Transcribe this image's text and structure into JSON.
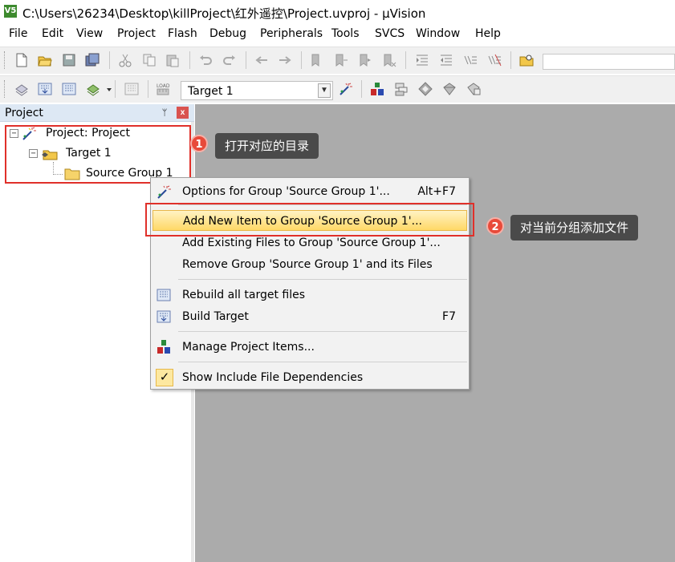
{
  "window": {
    "title": "C:\\Users\\26234\\Desktop\\killProject\\红外遥控\\Project.uvproj - µVision",
    "app_icon_text": "V5"
  },
  "menu": [
    "File",
    "Edit",
    "View",
    "Project",
    "Flash",
    "Debug",
    "Peripherals",
    "Tools",
    "SVCS",
    "Window",
    "Help"
  ],
  "toolbar": {
    "target_combo_value": "Target 1",
    "build_toolbar_load_label": "LOAD"
  },
  "project_panel": {
    "title": "Project",
    "pin_glyph": "ᛘ",
    "close_glyph": "x",
    "tree": {
      "root": "Project: Project",
      "target": "Target 1",
      "group": "Source Group 1"
    }
  },
  "context_menu": {
    "items": [
      {
        "label": "Options for Group 'Source Group 1'...",
        "shortcut": "Alt+F7",
        "icon": "options-wand-icon"
      },
      {
        "label": "Add New  Item to Group 'Source Group 1'...",
        "shortcut": "",
        "icon": "",
        "highlighted": true
      },
      {
        "label": "Add Existing Files to Group 'Source Group 1'...",
        "shortcut": "",
        "icon": ""
      },
      {
        "label": "Remove Group 'Source Group 1' and its Files",
        "shortcut": "",
        "icon": ""
      },
      {
        "label": "Rebuild all target files",
        "shortcut": "",
        "icon": "rebuild-icon"
      },
      {
        "label": "Build Target",
        "shortcut": "F7",
        "icon": "build-icon"
      },
      {
        "label": "Manage Project Items...",
        "shortcut": "",
        "icon": "manage-items-icon"
      },
      {
        "label": "Show Include File Dependencies",
        "shortcut": "",
        "icon": "checkmark-icon",
        "checked": true
      }
    ],
    "check_glyph": "✓"
  },
  "annotations": [
    {
      "number": "1",
      "text": "打开对应的目录"
    },
    {
      "number": "2",
      "text": "对当前分组添加文件"
    }
  ],
  "colors": {
    "annotation_red": "#e0302a",
    "editor_background": "#ababab",
    "highlight_yellow": "#ffd866",
    "panel_header": "#dde8f4"
  }
}
